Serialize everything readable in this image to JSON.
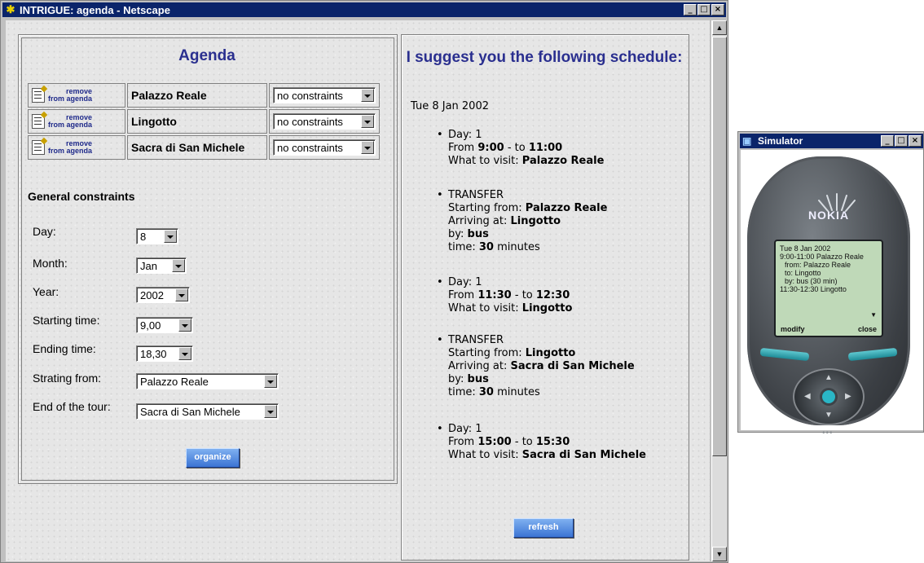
{
  "browser": {
    "title": "INTRIGUE: agenda - Netscape",
    "window_buttons": [
      "_",
      "□",
      "×"
    ]
  },
  "agenda": {
    "title": "Agenda",
    "remove_label_line1": "remove",
    "remove_label_line2": "from agenda",
    "items": [
      {
        "place": "Palazzo Reale",
        "constraint": "no constraints"
      },
      {
        "place": "Lingotto",
        "constraint": "no constraints"
      },
      {
        "place": "Sacra di San Michele",
        "constraint": "no constraints"
      }
    ]
  },
  "general_constraints": {
    "title": "General constraints",
    "fields": [
      {
        "label": "Day:",
        "value": "8"
      },
      {
        "label": "Month:",
        "value": "Jan"
      },
      {
        "label": "Year:",
        "value": "2002"
      },
      {
        "label": "Starting time:",
        "value": "9,00"
      },
      {
        "label": "Ending time:",
        "value": "18,30"
      },
      {
        "label": "Strating from:",
        "value": "Palazzo Reale"
      },
      {
        "label": "End of the tour:",
        "value": "Sacra di San Michele"
      }
    ],
    "organize_label": "organize"
  },
  "schedule": {
    "title": "I suggest you the following schedule:",
    "date": "Tue 8 Jan 2002",
    "items": [
      {
        "l1a": "Day: 1",
        "l2a": "From ",
        "l2b": "9:00",
        "l2c": " - to ",
        "l2d": "11:00",
        "l3a": "What to visit: ",
        "l3b": "Palazzo Reale"
      },
      {
        "l1a": "TRANSFER",
        "l2a": "Starting from: ",
        "l2b": "Palazzo Reale",
        "l3a": "Arriving at: ",
        "l3b": "Lingotto",
        "l4a": "by: ",
        "l4b": "bus",
        "l5a": "time: ",
        "l5b": "30",
        "l5c": " minutes"
      },
      {
        "l1a": "Day: 1",
        "l2a": "From ",
        "l2b": "11:30",
        "l2c": " - to ",
        "l2d": "12:30",
        "l3a": "What to visit: ",
        "l3b": "Lingotto"
      },
      {
        "l1a": "TRANSFER",
        "l2a": "Starting from: ",
        "l2b": "Lingotto",
        "l3a": "Arriving at: ",
        "l3b": "Sacra di San Michele",
        "l4a": "by: ",
        "l4b": "bus",
        "l5a": "time: ",
        "l5b": "30",
        "l5c": " minutes"
      },
      {
        "l1a": "Day: 1",
        "l2a": "From ",
        "l2b": "15:00",
        "l2c": " - to ",
        "l2d": "15:30",
        "l3a": "What to visit: ",
        "l3b": "Sacra di San Michele"
      }
    ],
    "refresh_label": "refresh"
  },
  "simulator": {
    "title": "Simulator",
    "brand": "NOKIA",
    "screen": {
      "line1": "Tue 8 Jan 2002",
      "line2": "9:00-11:00 Palazzo Reale",
      "line3": "from: Palazzo Reale",
      "line4": "to: Lingotto",
      "line5": "by: bus (30 min)",
      "line6": "11:30-12:30 Lingotto",
      "softkey_left": "modify",
      "softkey_right": "close"
    },
    "dots": "•••"
  }
}
